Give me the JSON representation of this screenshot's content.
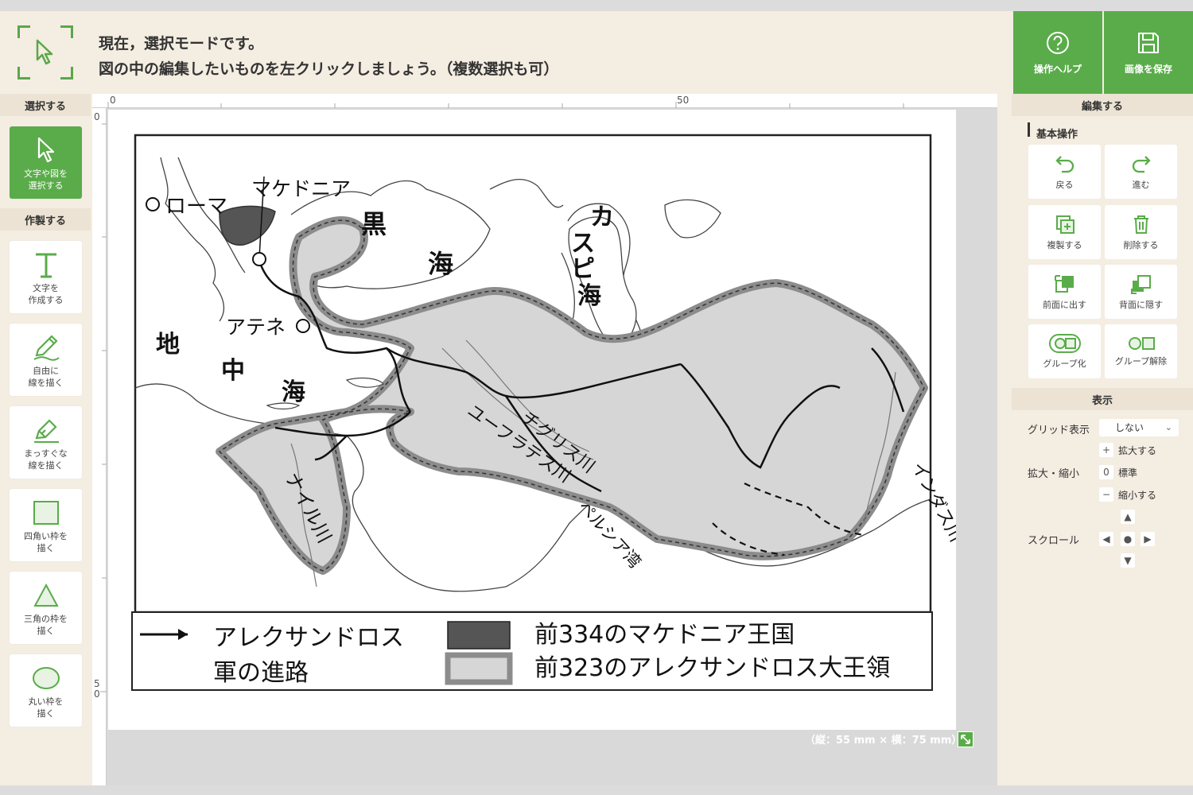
{
  "header": {
    "message_line1": "現在，選択モードです。",
    "message_line2": "図の中の編集したいものを左クリックしましょう。（複数選択も可）",
    "help_label": "操作ヘルプ",
    "save_label": "画像を保存"
  },
  "left_panel": {
    "select_title": "選択する",
    "create_title": "作製する",
    "tools": [
      {
        "label1": "文字や図を",
        "label2": "選択する"
      },
      {
        "label1": "文字を",
        "label2": "作成する"
      },
      {
        "label1": "自由に",
        "label2": "線を描く"
      },
      {
        "label1": "まっすぐな",
        "label2": "線を描く"
      },
      {
        "label1": "四角い枠を",
        "label2": "描く"
      },
      {
        "label1": "三角の枠を",
        "label2": "描く"
      },
      {
        "label1": "丸い枠を",
        "label2": "描く"
      }
    ]
  },
  "rulers": {
    "top_0": "0",
    "top_50": "50",
    "left_0": "0",
    "left_50a": "5",
    "left_50b": "0"
  },
  "map": {
    "labels": {
      "rome": "ローマ",
      "macedonia": "マケドニア",
      "athens": "アテネ",
      "black": "黒",
      "sea": "海",
      "caspian1": "カ",
      "caspian2": "ス",
      "caspian3": "ピ",
      "caspian4": "海",
      "med1": "地",
      "med2": "中",
      "med3": "海",
      "nile": "ナイル川",
      "euphrates": "ユーフラテス川",
      "tigris": "チグリス川",
      "persian_gulf": "ペルシア湾",
      "indus": "インダス川"
    },
    "legend": {
      "route_line1": "アレクサンドロス",
      "route_line2": "軍の進路",
      "kingdom": "前334のマケドニア王国",
      "empire": "前323のアレクサンドロス大王領"
    },
    "colors": {
      "kingdom": "#555555",
      "empire_fill": "#d6d6d6",
      "empire_border": "#8c8c8c"
    }
  },
  "canvas": {
    "dimensions": "（縦：55 mm × 横：75 mm）"
  },
  "right_panel": {
    "edit_title": "編集する",
    "basic_ops": "基本操作",
    "buttons": {
      "undo": "戻る",
      "redo": "進む",
      "duplicate": "複製する",
      "delete": "削除する",
      "front": "前面に出す",
      "back": "背面に隠す",
      "group": "グループ化",
      "ungroup": "グループ解除"
    },
    "display_title": "表示",
    "grid_label": "グリッド表示",
    "grid_value": "しない",
    "zoom_label": "拡大・縮小",
    "zoom_in": "拡大する",
    "zoom_reset": "標準",
    "zoom_out": "縮小する",
    "scroll_label": "スクロール"
  }
}
